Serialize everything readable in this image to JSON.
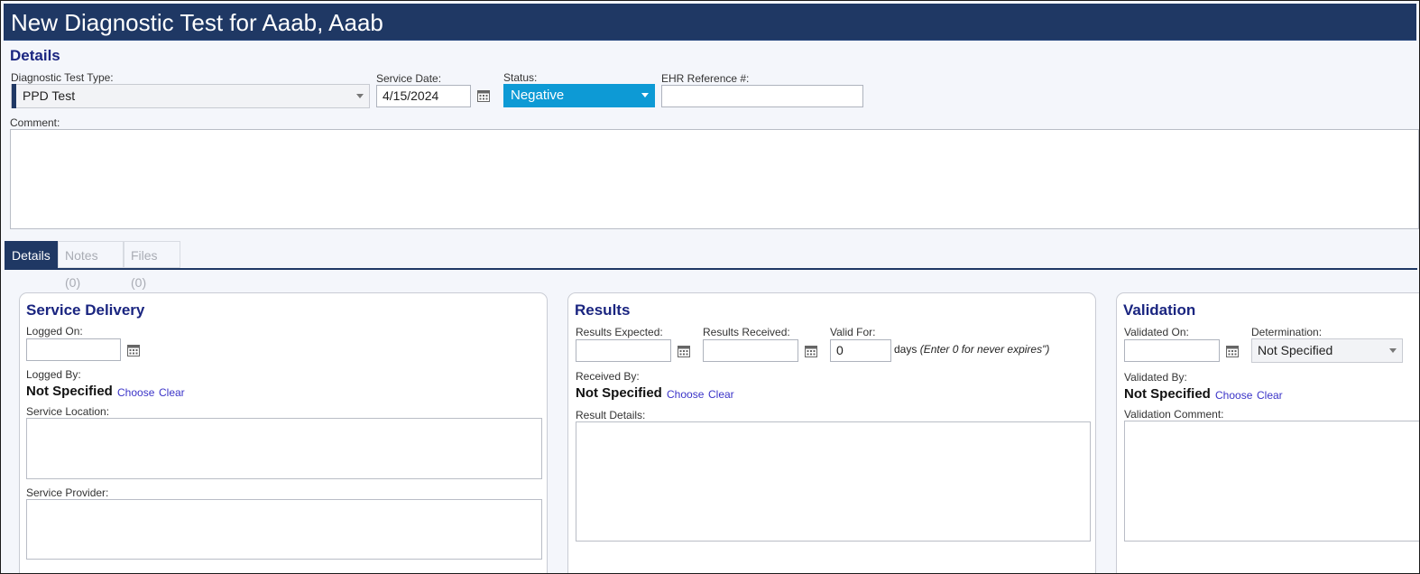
{
  "window": {
    "title": "New Diagnostic Test for Aaab, Aaab"
  },
  "details": {
    "heading": "Details",
    "test_type": {
      "label": "Diagnostic Test Type:",
      "value": "PPD Test"
    },
    "service_date": {
      "label": "Service Date:",
      "value": "4/15/2024"
    },
    "status": {
      "label": "Status:",
      "value": "Negative"
    },
    "ehr_ref": {
      "label": "EHR Reference #:",
      "value": ""
    },
    "comment": {
      "label": "Comment:",
      "value": ""
    }
  },
  "tabs": [
    {
      "label": "Details"
    },
    {
      "label": "Notes (0)"
    },
    {
      "label": "Files (0)"
    }
  ],
  "service_delivery": {
    "heading": "Service Delivery",
    "logged_on_label": "Logged On:",
    "logged_by_label": "Logged By:",
    "logged_by_value": "Not Specified",
    "choose": "Choose",
    "clear": "Clear",
    "location_label": "Service Location:",
    "provider_label": "Service Provider:"
  },
  "results": {
    "heading": "Results",
    "expected_label": "Results Expected:",
    "received_label": "Results Received:",
    "valid_for_label": "Valid For:",
    "valid_for_value": "0",
    "days_text": "days",
    "days_hint": "(Enter 0 for never expires\")",
    "received_by_label": "Received By:",
    "received_by_value": "Not Specified",
    "choose": "Choose",
    "clear": "Clear",
    "details_label": "Result Details:"
  },
  "validation": {
    "heading": "Validation",
    "validated_on_label": "Validated On:",
    "determination_label": "Determination:",
    "determination_value": "Not Specified",
    "validated_by_label": "Validated By:",
    "validated_by_value": "Not Specified",
    "choose": "Choose",
    "clear": "Clear",
    "comment_label": "Validation Comment:"
  },
  "colors": {
    "titlebar": "#1f3864",
    "status": "#0d9ad5",
    "heading": "#1a2580",
    "link": "#3b34c8"
  },
  "icons": {
    "calendar": "calendar-icon",
    "dropdown": "chevron-down-icon"
  }
}
